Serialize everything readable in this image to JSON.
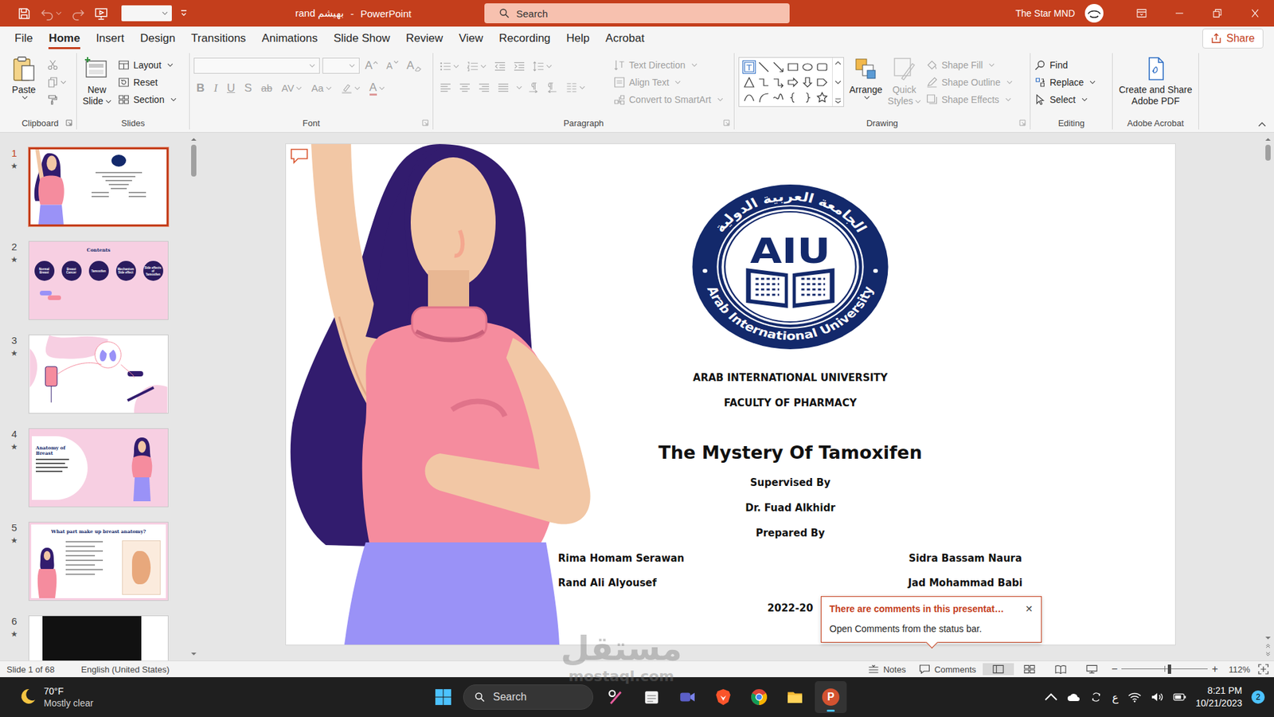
{
  "titlebar": {
    "quick_access": [
      {
        "kind": "save",
        "disabled": false
      },
      {
        "kind": "undo",
        "disabled": true
      },
      {
        "kind": "redo",
        "disabled": true
      },
      {
        "kind": "present",
        "disabled": false
      }
    ],
    "document": "rand بهيشم",
    "separator": "-",
    "app": "PowerPoint",
    "search_placeholder": "Search",
    "user": "The Star MND"
  },
  "menu": [
    {
      "label": "File",
      "selected": false
    },
    {
      "label": "Home",
      "selected": true
    },
    {
      "label": "Insert",
      "selected": false
    },
    {
      "label": "Design",
      "selected": false
    },
    {
      "label": "Transitions",
      "selected": false
    },
    {
      "label": "Animations",
      "selected": false
    },
    {
      "label": "Slide Show",
      "selected": false
    },
    {
      "label": "Review",
      "selected": false
    },
    {
      "label": "View",
      "selected": false
    },
    {
      "label": "Recording",
      "selected": false
    },
    {
      "label": "Help",
      "selected": false
    },
    {
      "label": "Acrobat",
      "selected": false
    }
  ],
  "share": "Share",
  "ribbon": {
    "clipboard": {
      "label": "Clipboard",
      "paste": "Paste"
    },
    "slides": {
      "label": "Slides",
      "new_slide": [
        "New",
        "Slide"
      ],
      "commands": [
        {
          "kind": "layout",
          "label": "Layout",
          "dropdown": true
        },
        {
          "kind": "reset",
          "label": "Reset",
          "dropdown": false
        },
        {
          "kind": "section",
          "label": "Section",
          "dropdown": true
        }
      ]
    },
    "font": {
      "label": "Font",
      "disabled": true,
      "size_tools": [
        {
          "kind": "grow",
          "glyph": "A"
        },
        {
          "kind": "shrink",
          "glyph": "A"
        },
        {
          "kind": "clear",
          "glyph": "A"
        }
      ],
      "styles": [
        {
          "kind": "bold",
          "glyph": "B",
          "dropdown": false
        },
        {
          "kind": "italic",
          "glyph": "I",
          "dropdown": false
        },
        {
          "kind": "underline",
          "glyph": "U",
          "dropdown": false
        },
        {
          "kind": "shadow",
          "glyph": "S",
          "dropdown": false
        },
        {
          "kind": "strike",
          "glyph": "ab",
          "dropdown": false
        },
        {
          "kind": "spacing",
          "glyph": "AV",
          "dropdown": true
        },
        {
          "kind": "case",
          "glyph": "Aa",
          "dropdown": true
        },
        {
          "kind": "highlight",
          "dropdown": true
        },
        {
          "kind": "color",
          "glyph": "A",
          "dropdown": true
        }
      ]
    },
    "paragraph": {
      "label": "Paragraph",
      "disabled": true,
      "commands": [
        {
          "kind": "direction",
          "label": "Text Direction"
        },
        {
          "kind": "align",
          "label": "Align Text"
        },
        {
          "kind": "smartart",
          "label": "Convert to SmartArt"
        }
      ]
    },
    "drawing": {
      "label": "Drawing",
      "arrange": "Arrange",
      "quick_styles": {
        "lines": [
          "Quick",
          "Styles"
        ],
        "disabled": true
      },
      "shape_commands": [
        {
          "kind": "fill",
          "label": "Shape Fill",
          "disabled": true
        },
        {
          "kind": "outline",
          "label": "Shape Outline",
          "disabled": true
        },
        {
          "kind": "effects",
          "label": "Shape Effects",
          "disabled": true
        }
      ]
    },
    "editing": {
      "label": "Editing",
      "commands": [
        {
          "kind": "find",
          "label": "Find",
          "dropdown": false
        },
        {
          "kind": "replace",
          "label": "Replace",
          "dropdown": true
        },
        {
          "kind": "select",
          "label": "Select",
          "dropdown": true
        }
      ]
    },
    "acrobat": {
      "label": "Adobe Acrobat",
      "button": [
        "Create and Share",
        "Adobe PDF"
      ]
    }
  },
  "thumbnails": {
    "animation_mark": "★",
    "items": [
      {
        "number": "1",
        "selected": true,
        "animated": true,
        "kind": "title"
      },
      {
        "number": "2",
        "selected": false,
        "animated": true,
        "kind": "contents",
        "title": "Contents",
        "topics": [
          "Normal Breast",
          "Breast Cancer",
          "Tamoxifen",
          "Mechanism Side effect",
          "Side effects of Tamoxifen"
        ]
      },
      {
        "number": "3",
        "selected": false,
        "animated": true,
        "kind": "diagram"
      },
      {
        "number": "4",
        "selected": false,
        "animated": true,
        "kind": "anatomy",
        "title": "Anatomy of Breast"
      },
      {
        "number": "5",
        "selected": false,
        "animated": true,
        "kind": "parts",
        "title": "What part make up breast anatomy?"
      },
      {
        "number": "6",
        "selected": false,
        "animated": true,
        "kind": "photo"
      }
    ]
  },
  "slide": {
    "logo": {
      "initials": "AIU",
      "arabic": "الجامعة العربية الدولية",
      "english": "Arab International University"
    },
    "university": "ARAB INTERNATIONAL UNIVERSITY",
    "faculty": "FACULTY OF PHARMACY",
    "title": "The Mystery Of Tamoxifen",
    "supervised_label": "Supervised By",
    "supervisor": "Dr. Fuad Alkhidr",
    "prepared_label": "Prepared By",
    "authors_left": [
      "Rima Homam Serawan",
      "Rand Ali Alyousef"
    ],
    "authors_right": [
      "Sidra Bassam Naura",
      "Jad Mohammad Babi"
    ],
    "year": "2022-20"
  },
  "comment_popup": {
    "title": "There are comments in this presentat…",
    "body": "Open Comments from the status bar.",
    "close": "✕"
  },
  "status_bar": {
    "slide": "Slide 1 of 68",
    "language": "English (United States)",
    "notes": "Notes",
    "comments": "Comments",
    "views": [
      {
        "kind": "normal",
        "selected": true
      },
      {
        "kind": "sorter",
        "selected": false
      },
      {
        "kind": "reading",
        "selected": false
      },
      {
        "kind": "slideshow",
        "selected": false
      }
    ],
    "zoom_out": "−",
    "zoom_in": "+",
    "zoom": "112%",
    "zoom_level": 0.55
  },
  "taskbar": {
    "weather": {
      "temperature": "70°F",
      "condition": "Mostly clear"
    },
    "search": "Search",
    "apps": [
      {
        "kind": "tools",
        "active": false
      },
      {
        "kind": "notes",
        "active": false
      },
      {
        "kind": "meet",
        "active": false
      },
      {
        "kind": "brave",
        "active": false
      },
      {
        "kind": "chrome",
        "active": false
      },
      {
        "kind": "explorer",
        "active": false
      },
      {
        "kind": "powerpoint",
        "active": true,
        "glyph": "P"
      }
    ],
    "tray": {
      "language": "ع",
      "notifications": "2"
    },
    "time": "8:21 PM",
    "date": "10/21/2023"
  },
  "watermark": {
    "arabic": "مستقل",
    "latin": "mostaql.com"
  }
}
